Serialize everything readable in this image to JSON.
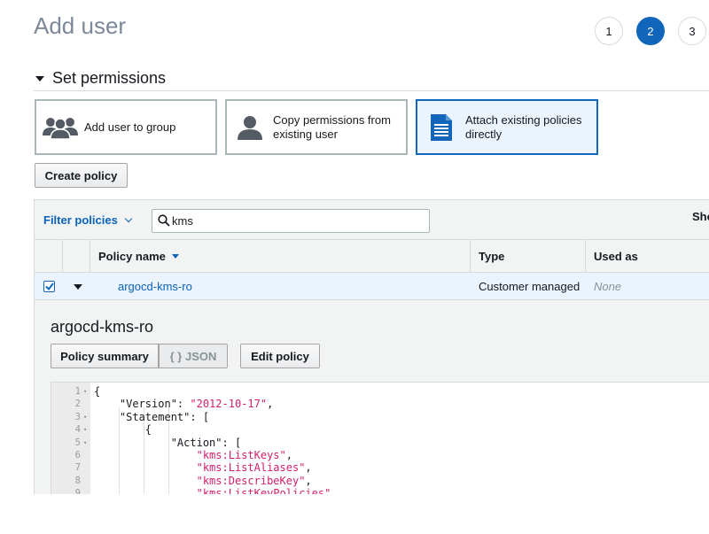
{
  "header": {
    "title": "Add user",
    "steps": [
      "1",
      "2",
      "3"
    ],
    "active_step": "2"
  },
  "section": {
    "title": "Set permissions"
  },
  "permission_options": [
    {
      "label": "Add user to group",
      "icon": "users-group-icon",
      "selected": false
    },
    {
      "label": "Copy permissions from existing user",
      "icon": "user-icon",
      "selected": false
    },
    {
      "label": "Attach existing policies directly",
      "icon": "document-icon",
      "selected": true
    }
  ],
  "toolbar": {
    "create_policy_label": "Create policy"
  },
  "filter": {
    "label": "Filter policies",
    "search_value": "kms",
    "show_label": "Sho"
  },
  "table": {
    "columns": [
      "Policy name",
      "Type",
      "Used as"
    ],
    "rows": [
      {
        "checked": true,
        "name": "argocd-kms-ro",
        "type": "Customer managed",
        "used_as": "None"
      }
    ]
  },
  "detail": {
    "title": "argocd-kms-ro",
    "tab_summary": "Policy summary",
    "tab_json": "{ } JSON",
    "edit_label": "Edit policy",
    "json_lines": [
      {
        "n": "1",
        "fold": true,
        "parts": [
          [
            "k",
            "{"
          ]
        ]
      },
      {
        "n": "2",
        "fold": false,
        "parts": [
          [
            "k",
            "    \"Version\": "
          ],
          [
            "s",
            "\"2012-10-17\""
          ],
          [
            "k",
            ","
          ]
        ]
      },
      {
        "n": "3",
        "fold": true,
        "parts": [
          [
            "k",
            "    \"Statement\": ["
          ]
        ]
      },
      {
        "n": "4",
        "fold": true,
        "parts": [
          [
            "k",
            "        {"
          ]
        ]
      },
      {
        "n": "5",
        "fold": true,
        "parts": [
          [
            "k",
            "            \"Action\": ["
          ]
        ]
      },
      {
        "n": "6",
        "fold": false,
        "parts": [
          [
            "s",
            "                \"kms:ListKeys\""
          ],
          [
            "k",
            ","
          ]
        ]
      },
      {
        "n": "7",
        "fold": false,
        "parts": [
          [
            "s",
            "                \"kms:ListAliases\""
          ],
          [
            "k",
            ","
          ]
        ]
      },
      {
        "n": "8",
        "fold": false,
        "parts": [
          [
            "s",
            "                \"kms:DescribeKey\""
          ],
          [
            "k",
            ","
          ]
        ]
      },
      {
        "n": "9",
        "fold": false,
        "parts": [
          [
            "s",
            "                \"kms:ListKeyPolicies\""
          ],
          [
            "k",
            ","
          ]
        ]
      }
    ]
  },
  "colors": {
    "accent": "#1166bb",
    "link": "#0a63b8",
    "json_string": "#d11f6b",
    "selected_bg": "#eaf3fe"
  }
}
